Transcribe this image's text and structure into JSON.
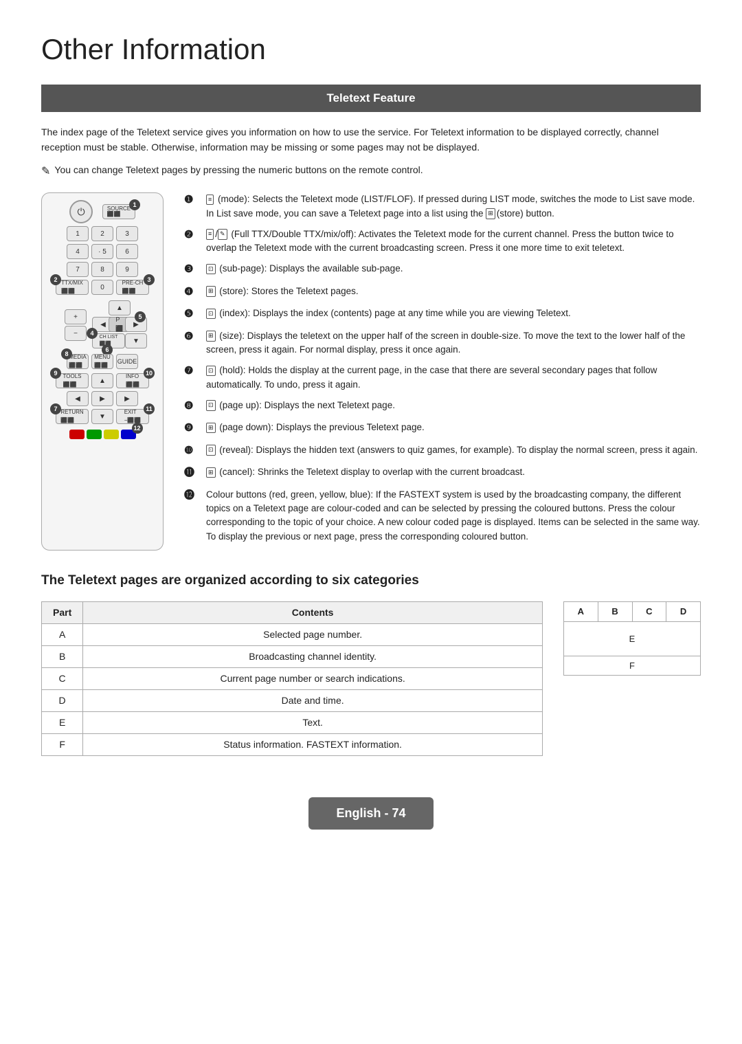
{
  "page": {
    "title": "Other Information",
    "section_header": "Teletext Feature",
    "intro": "The index page of the Teletext service gives you information on how to use the service. For Teletext information to be displayed correctly, channel reception must be stable. Otherwise, information may be missing or some pages may not be displayed.",
    "tip": "You can change Teletext pages by pressing the numeric buttons on the remote control.",
    "descriptions": [
      {
        "num": "❶",
        "icon_label": "LIST/FLOF",
        "text": "(mode): Selects the Teletext mode (LIST/FLOF). If pressed during LIST mode, switches the mode to List save mode. In List save mode, you can save a Teletext page into a list using the (store) button."
      },
      {
        "num": "❷",
        "icon_label": "TTX/MIX",
        "text": "(Full TTX/Double TTX/mix/off): Activates the Teletext mode for the current channel. Press the button twice to overlap the Teletext mode with the current broadcasting screen. Press it one more time to exit teletext."
      },
      {
        "num": "❸",
        "icon_label": "sub-page",
        "text": "(sub-page): Displays the available sub-page."
      },
      {
        "num": "❹",
        "icon_label": "store",
        "text": "(store): Stores the Teletext pages."
      },
      {
        "num": "❺",
        "icon_label": "index",
        "text": "(index): Displays the index (contents) page at any time while you are viewing Teletext."
      },
      {
        "num": "❻",
        "icon_label": "size",
        "text": "(size): Displays the teletext on the upper half of the screen in double-size. To move the text to the lower half of the screen, press it again. For normal display, press it once again."
      },
      {
        "num": "❼",
        "icon_label": "hold",
        "text": "(hold): Holds the display at the current page, in the case that there are several secondary pages that follow automatically. To undo, press it again."
      },
      {
        "num": "❽",
        "icon_label": "page up",
        "text": "(page up): Displays the next Teletext page."
      },
      {
        "num": "❾",
        "icon_label": "page down",
        "text": "(page down): Displays the previous Teletext page."
      },
      {
        "num": "❿",
        "icon_label": "reveal",
        "text": "(reveal): Displays the hidden text (answers to quiz games, for example). To display the normal screen, press it again."
      },
      {
        "num": "⓫",
        "icon_label": "cancel",
        "text": "(cancel): Shrinks the Teletext display to overlap with the current broadcast."
      },
      {
        "num": "⓬",
        "icon_label": "colour",
        "text": "Colour buttons (red, green, yellow, blue): If the FASTEXT system is used by the broadcasting company, the different topics on a Teletext page are colour-coded and can be selected by pressing the coloured buttons. Press the colour corresponding to the topic of your choice. A new colour coded page is displayed. Items can be selected in the same way. To display the previous or next page, press the corresponding coloured button."
      }
    ],
    "table_section_title": "The Teletext pages are organized according to six categories",
    "table": {
      "headers": [
        "Part",
        "Contents"
      ],
      "rows": [
        [
          "A",
          "Selected page number."
        ],
        [
          "B",
          "Broadcasting channel identity."
        ],
        [
          "C",
          "Current page number or search indications."
        ],
        [
          "D",
          "Date and time."
        ],
        [
          "E",
          "Text."
        ],
        [
          "F",
          "Status information. FASTEXT information."
        ]
      ]
    },
    "abcd_headers": [
      "A",
      "B",
      "C",
      "D"
    ],
    "abcd_e_label": "E",
    "abcd_f_label": "F",
    "footer": "English - 74"
  }
}
